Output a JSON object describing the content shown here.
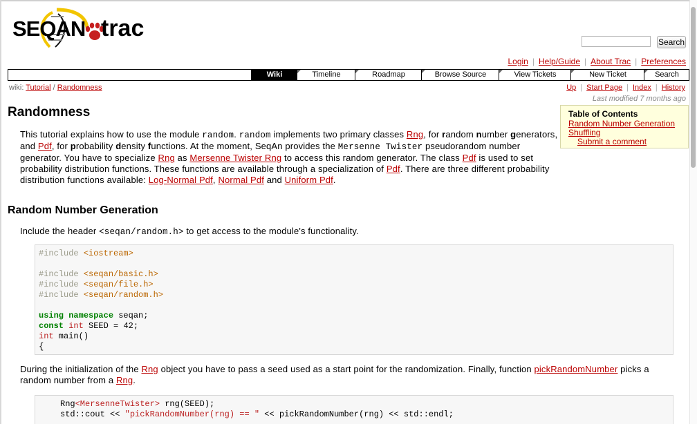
{
  "logo": {
    "seqan_text": "SEQAN",
    "trac_text": "trac"
  },
  "search": {
    "placeholder": "",
    "button_label": "Search"
  },
  "metanav": [
    "Login",
    "Help/Guide",
    "About Trac",
    "Preferences"
  ],
  "mainnav": [
    "Wiki",
    "Timeline",
    "Roadmap",
    "Browse Source",
    "View Tickets",
    "New Ticket",
    "Search"
  ],
  "breadcrumb": {
    "prefix": "wiki:",
    "parts": [
      "Tutorial",
      "/",
      "Randomness"
    ]
  },
  "ctxtnav": [
    "Up",
    "Start Page",
    "Index",
    "History"
  ],
  "last_modified": "Last modified 7 months ago",
  "toc": {
    "title": "Table of Contents",
    "items": [
      "Random Number Generation",
      "Shuffling",
      "Submit a comment"
    ]
  },
  "page_title": "Randomness",
  "intro": {
    "t1": "This tutorial explains how to use the module ",
    "m1": "random",
    "t2": ". ",
    "m2": "random",
    "t3": " implements two primary classes ",
    "l1": "Rng",
    "t4": ", for ",
    "b1": "r",
    "t5": "andom ",
    "b2": "n",
    "t6": "umber ",
    "b3": "g",
    "t7": "enerators, and ",
    "l2": "Pdf",
    "t8": ", for ",
    "b4": "p",
    "t9": "robability ",
    "b5": "d",
    "t10": "ensity ",
    "b6": "f",
    "t11": "unctions. At the moment, SeqAn provides the ",
    "m3": "Mersenne Twister",
    "t12": " pseudorandom number generator. You have to specialize ",
    "l3": "Rng",
    "t13": " as ",
    "l4": "Mersenne Twister Rng",
    "t14": " to access this random generator. The class ",
    "l5": "Pdf",
    "t15": " is used to set probability distribution functions. These functions are available through a specialization of ",
    "l6": "Pdf",
    "t16": ". There are three different probability distribution functions available: ",
    "l7": "Log-Normal Pdf",
    "t17": ", ",
    "l8": "Normal Pdf",
    "t18": " and ",
    "l9": "Uniform Pdf",
    "t19": "."
  },
  "section1_heading": "Random Number Generation",
  "include_para": {
    "t1": "Include the header ",
    "m1": "<seqan/random.h>",
    "t2": " to get access to the module's functionality."
  },
  "code1": {
    "inc1_pp": "#include ",
    "inc1_file": "<iostream>",
    "inc2_pp": "#include ",
    "inc2_file": "<seqan/basic.h>",
    "inc3_pp": "#include ",
    "inc3_file": "<seqan/file.h>",
    "inc4_pp": "#include ",
    "inc4_file": "<seqan/random.h>",
    "using_kw": "using",
    "namespace_kw": "namespace",
    "using_rest": " seqan;",
    "const_kw": "const",
    "int_ty": "int",
    "const_rest": " SEED = 42;",
    "main_ty": "int",
    "main_rest": " main()",
    "brace": "{"
  },
  "init_para": {
    "t1": "During the initialization of the ",
    "l1": "Rng",
    "t2": " object you have to pass a seed used as a start point for the randomization. Finally, function ",
    "l2": "pickRandomNumber",
    "t3": " picks a random number from a ",
    "l3": "Rng",
    "t4": "."
  },
  "code2": {
    "line1_a": "Rng",
    "line1_b": "<MersenneTwister>",
    "line1_c": " rng(SEED);",
    "line2_a": "std::cout << ",
    "line2_str": "\"pickRandomNumber(rng) == \"",
    "line2_c": " << pickRandomNumber(rng) << std::endl;"
  },
  "colors": {
    "link": "#bb0000",
    "toc_bg": "#ffffdd",
    "code_bg": "#f7f7f7",
    "logo_yellow": "#f2c500",
    "logo_red": "#c61f1f"
  }
}
